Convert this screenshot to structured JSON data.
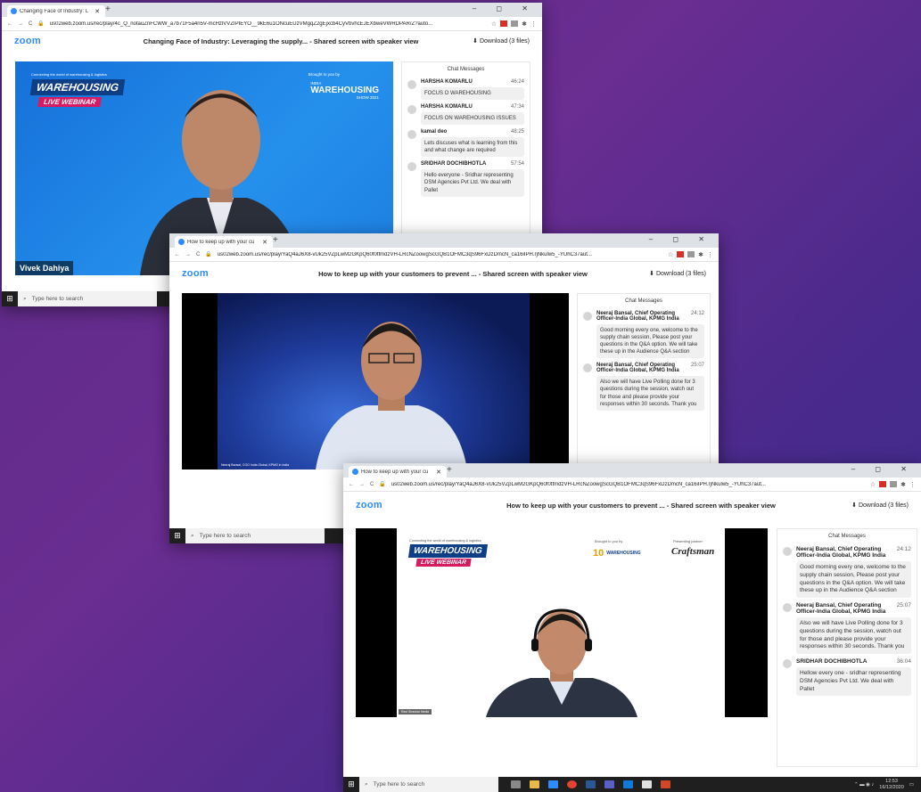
{
  "windows": [
    {
      "tab_title": "Changing Face of Industry: L",
      "url": "us02web.zoom.us/rec/play/4c_Q_notauZriFCWW_a7b71F5a4n5V-mcHzlVVZIPIEYO__9kE6u1ONcuEUzVMgqZ2gEjxcb4CyVbvhcEJEXbweVWRDPAR/Z?auto...",
      "title": "Changing Face of Industry: Leveraging the supply... - Shared screen with speaker view",
      "download": "Download (3 files)",
      "chat_header": "Chat Messages",
      "speaker_name": "Vivek Dahiya",
      "banner": {
        "top_small": "Connecting the world of warehousing & logistics",
        "main": "WAREHOUSING",
        "live": "LIVE WEBINAR",
        "brought": "Brought to you by",
        "india": "INDIA",
        "logo_main": "WAREHOUSING",
        "show": "SHOW 2021"
      },
      "messages": [
        {
          "name": "HARSHA KOMARLU",
          "time": "46:24",
          "text": "FOCUS O WAREHOUSING"
        },
        {
          "name": "HARSHA KOMARLU",
          "time": "47:34",
          "text": "FOCUS ON WAREHOUSING ISSUES"
        },
        {
          "name": "kamal deo",
          "time": "48:25",
          "text": "Lets discuses what is learning from this and what change are required"
        },
        {
          "name": "SRIDHAR DOCHIBHOTLA",
          "time": "57:54",
          "text": "Hello everyone - Sridhar representing DSM Agencies Pvt Ltd. We deal with Pallet"
        }
      ],
      "search_placeholder": "Type here to search"
    },
    {
      "tab_title": "How to keep up with your cu",
      "url": "us02web.zoom.us/rec/play/YaQ4aJ6X8-vUk25VZpLwM2GKpQ60f0tfmdzVH-LRcNZoowgScGQB1OFMC3qS96FxDzDmcN_ca16iIPH.rjNkulw5_-YUhC37aut...",
      "title": "How to keep up with your customers to prevent ... - Shared screen with speaker view",
      "download": "Download (3 files)",
      "chat_header": "Chat Messages",
      "caption": "Neeraj Bansal, COO India Global, KPMG in India",
      "messages": [
        {
          "name": "Neeraj Bansal, Chief Operating Officer-India Global, KPMG India",
          "time": "24:12",
          "text": "Good morning every one, welcome to the supply chain session, Please post your questions in the Q&A option. We will take these up in the Audience Q&A section"
        },
        {
          "name": "Neeraj Bansal, Chief Operating Officer-India Global, KPMG India",
          "time": "25:07",
          "text": "Also we will have Live Polling done for 3 questions during the session, watch out for those and please provide your responses within 30 seconds. Thank you"
        }
      ],
      "search_placeholder": "Type here to search"
    },
    {
      "tab_title": "How to keep up with your cu",
      "url": "us02web.zoom.us/rec/play/YaQ4aJ6X8-vUk25VZpLwM2GKpQ60f0tfmdzVH-LRcNZoowgScGQB1OFMC3qS96FxDzDmcN_ca16iIPH.rjNkulw5_-YUhC37aut...",
      "title": "How to keep up with your customers to prevent ... - Shared screen with speaker view",
      "download": "Download (3 files)",
      "chat_header": "Chat Messages",
      "caption": "Ravi Shankar Nedia",
      "banner": {
        "top_small": "Connecting the world of warehousing & logistics",
        "main": "WAREHOUSING",
        "live": "LIVE WEBINAR",
        "brought": "Brought to you by",
        "ten": "10",
        "logo_main": "WAREHOUSING",
        "presenting": "Presenting partner",
        "craftsman": "Craftsman"
      },
      "messages": [
        {
          "name": "Neeraj Bansal, Chief Operating Officer-India Global, KPMG India",
          "time": "24:12",
          "text": "Good morning every one, welcome to the supply chain session, Please post your questions in the Q&A option. We will take these up in the Audience Q&A section"
        },
        {
          "name": "Neeraj Bansal, Chief Operating Officer-India Global, KPMG India",
          "time": "25:07",
          "text": "Also we will have Live Polling done for 3 questions during the session, watch out for those and please provide your responses within 30 seconds. Thank you"
        },
        {
          "name": "SRIDHAR DOCHIBHOTLA",
          "time": "36:04",
          "text": "Hellow every one - sridhar representing DSM Agencies Pvt Ltd. We deal with Pallet"
        }
      ],
      "search_placeholder": "Type here to search",
      "clock_time": "12:53",
      "clock_date": "16/12/2020"
    }
  ],
  "zoom_logo": "zoom",
  "window_controls": "–  ◻  ✕",
  "colors": {
    "zoom_blue": "#2d8cff",
    "banner_navy": "#0e3e86",
    "live_pink": "#d81b60"
  }
}
